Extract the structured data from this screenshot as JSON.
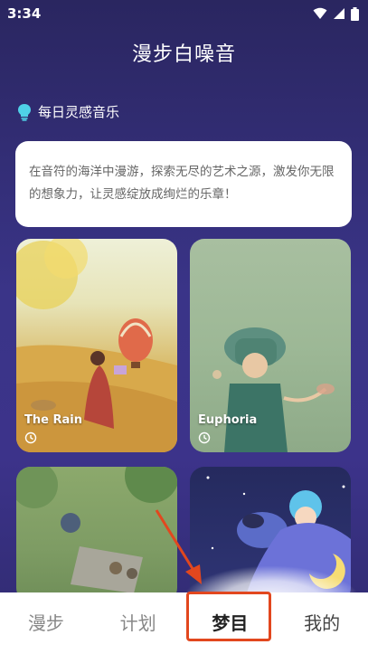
{
  "status_bar": {
    "time": "3:34"
  },
  "app": {
    "title": "漫步白噪音"
  },
  "section": {
    "title": "每日灵感音乐",
    "icon": "lightbulb-icon"
  },
  "intro": {
    "text": "在音符的海洋中漫游，探索无尽的艺术之源，激发你无限的想象力，让灵感绽放成绚烂的乐章！"
  },
  "cards": [
    {
      "title": "The Rain",
      "icon": "clock-icon"
    },
    {
      "title": "Euphoria",
      "icon": "clock-icon"
    },
    {
      "title": "",
      "icon": ""
    },
    {
      "title": "",
      "icon": ""
    }
  ],
  "nav": {
    "tabs": [
      {
        "label": "漫步"
      },
      {
        "label": "计划"
      },
      {
        "label": "梦目"
      },
      {
        "label": "我的"
      }
    ],
    "active_index": 2
  },
  "colors": {
    "highlight_box": "#e2471e",
    "arrow": "#e2471e",
    "card_bg": "#ffffff"
  }
}
